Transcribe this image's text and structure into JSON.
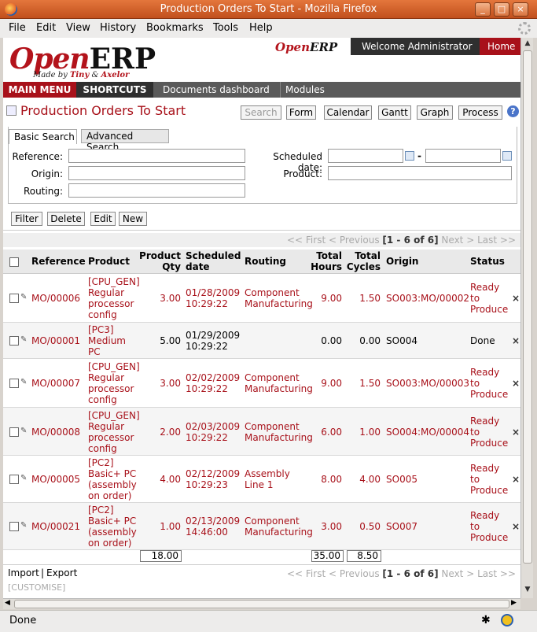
{
  "window": {
    "title": "Production Orders To Start - Mozilla Firefox"
  },
  "menu": {
    "file": "File",
    "edit": "Edit",
    "view": "View",
    "history": "History",
    "bookmarks": "Bookmarks",
    "tools": "Tools",
    "help": "Help"
  },
  "header": {
    "logo_open": "Open",
    "logo_erp": "ERP",
    "logo_made_by": "Made by ",
    "logo_tiny": "Tiny",
    "logo_amp": " & ",
    "logo_axelor": "Axelor",
    "small_logo_open": "Open",
    "small_logo_erp": "ERP",
    "welcome": "Welcome Administrator",
    "home": "Home"
  },
  "nav": {
    "main_menu": "MAIN MENU",
    "shortcuts": "SHORTCUTS",
    "documents_dashboard": "Documents dashboard",
    "modules": "Modules"
  },
  "page": {
    "title": "Production Orders To Start",
    "buttons": {
      "search": "Search",
      "form": "Form",
      "calendar": "Calendar",
      "gantt": "Gantt",
      "graph": "Graph",
      "process": "Process"
    },
    "help": "?"
  },
  "search": {
    "tab_basic": "Basic Search",
    "tab_advanced": "Advanced Search",
    "reference_label": "Reference:",
    "origin_label": "Origin:",
    "routing_label": "Routing:",
    "scheduled_label": "Scheduled date:",
    "date_sep": "-",
    "product_label": "Product:"
  },
  "actions": {
    "filter": "Filter",
    "delete": "Delete",
    "edit": "Edit",
    "new": "New"
  },
  "pager": {
    "first": "<< First",
    "previous": "< Previous",
    "range": "[1 - 6 of 6]",
    "next": "Next >",
    "last": "Last >>"
  },
  "columns": {
    "reference": "Reference",
    "product": "Product",
    "product_qty_1": "Product",
    "product_qty_2": "Qty",
    "scheduled_1": "Scheduled",
    "scheduled_2": "date",
    "routing": "Routing",
    "total_hours_1": "Total",
    "total_hours_2": "Hours",
    "total_cycles_1": "Total",
    "total_cycles_2": "Cycles",
    "origin": "Origin",
    "status": "Status"
  },
  "rows": [
    {
      "ref": "MO/00006",
      "product": [
        "[CPU_GEN]",
        "Regular",
        "processor",
        "config"
      ],
      "qty": "3.00",
      "date": [
        "01/28/2009",
        "10:29:22"
      ],
      "routing": [
        "Component",
        "Manufacturing"
      ],
      "hours": "9.00",
      "cycles": "1.50",
      "origin": "SO003:MO/00002",
      "status": [
        "Ready",
        "to",
        "Produce"
      ],
      "delete": "×"
    },
    {
      "ref": "MO/00001",
      "product": [
        "[PC3]",
        "Medium",
        "PC"
      ],
      "qty": "5.00",
      "date": [
        "01/29/2009",
        "10:29:22"
      ],
      "routing": [],
      "hours": "0.00",
      "cycles": "0.00",
      "origin": "SO004",
      "status": [
        "Done"
      ],
      "delete": "×"
    },
    {
      "ref": "MO/00007",
      "product": [
        "[CPU_GEN]",
        "Regular",
        "processor",
        "config"
      ],
      "qty": "3.00",
      "date": [
        "02/02/2009",
        "10:29:22"
      ],
      "routing": [
        "Component",
        "Manufacturing"
      ],
      "hours": "9.00",
      "cycles": "1.50",
      "origin": "SO003:MO/00003",
      "status": [
        "Ready",
        "to",
        "Produce"
      ],
      "delete": "×"
    },
    {
      "ref": "MO/00008",
      "product": [
        "[CPU_GEN]",
        "Regular",
        "processor",
        "config"
      ],
      "qty": "2.00",
      "date": [
        "02/03/2009",
        "10:29:22"
      ],
      "routing": [
        "Component",
        "Manufacturing"
      ],
      "hours": "6.00",
      "cycles": "1.00",
      "origin": "SO004:MO/00004",
      "status": [
        "Ready",
        "to",
        "Produce"
      ],
      "delete": "×"
    },
    {
      "ref": "MO/00005",
      "product": [
        "[PC2]",
        "Basic+ PC",
        "(assembly",
        "on order)"
      ],
      "qty": "4.00",
      "date": [
        "02/12/2009",
        "10:29:23"
      ],
      "routing": [
        "Assembly",
        "Line 1"
      ],
      "hours": "8.00",
      "cycles": "4.00",
      "origin": "SO005",
      "status": [
        "Ready",
        "to",
        "Produce"
      ],
      "delete": "×"
    },
    {
      "ref": "MO/00021",
      "product": [
        "[PC2]",
        "Basic+ PC",
        "(assembly",
        "on order)"
      ],
      "qty": "1.00",
      "date": [
        "02/13/2009",
        "14:46:00"
      ],
      "routing": [
        "Component",
        "Manufacturing"
      ],
      "hours": "3.00",
      "cycles": "0.50",
      "origin": "SO007",
      "status": [
        "Ready",
        "to",
        "Produce"
      ],
      "delete": "×"
    }
  ],
  "totals": {
    "qty": "18.00",
    "hours": "35.00",
    "cycles": "8.50"
  },
  "footer": {
    "import": "Import",
    "sep": "|",
    "export": "Export",
    "customise": "[CUSTOMISE]"
  },
  "status": {
    "text": "Done"
  },
  "colors": {
    "accent": "#a8111a",
    "titlebar": "#d45f2b"
  }
}
